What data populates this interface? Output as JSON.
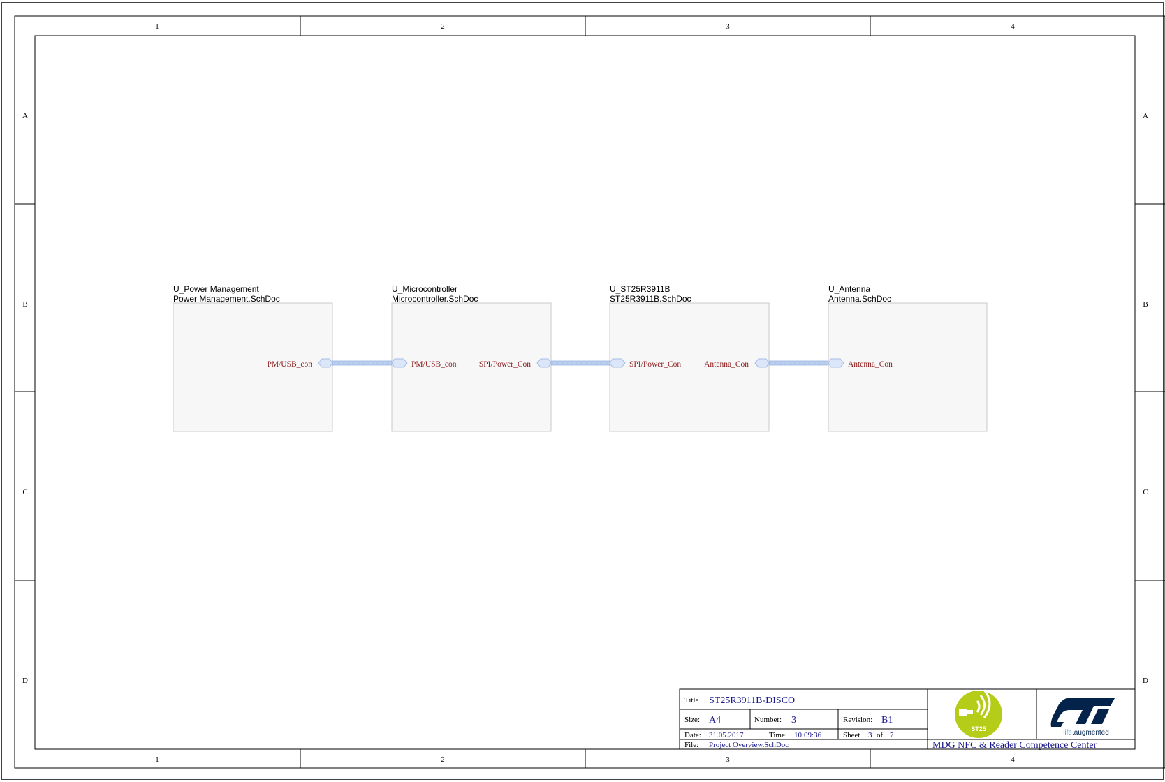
{
  "border": {
    "columns": [
      "1",
      "2",
      "3",
      "4"
    ],
    "rows": [
      "A",
      "B",
      "C",
      "D"
    ]
  },
  "sheets": [
    {
      "designator": "U_Power Management",
      "file": "Power Management.SchDoc",
      "ports": [
        {
          "label": "PM/USB_con",
          "side": "right"
        }
      ]
    },
    {
      "designator": "U_Microcontroller",
      "file": "Microcontroller.SchDoc",
      "ports": [
        {
          "label": "PM/USB_con",
          "side": "left"
        },
        {
          "label": "SPI/Power_Con",
          "side": "right"
        }
      ]
    },
    {
      "designator": "U_ST25R3911B",
      "file": "ST25R3911B.SchDoc",
      "ports": [
        {
          "label": "SPI/Power_Con",
          "side": "left"
        },
        {
          "label": "Antenna_Con",
          "side": "right"
        }
      ]
    },
    {
      "designator": "U_Antenna",
      "file": "Antenna.SchDoc",
      "ports": [
        {
          "label": "Antenna_Con",
          "side": "left"
        }
      ]
    }
  ],
  "title_block": {
    "title_label": "Title",
    "title": "ST25R3911B-DISCO",
    "size_label": "Size:",
    "size": "A4",
    "number_label": "Number:",
    "number": "3",
    "revision_label": "Revision:",
    "revision": "B1",
    "date_label": "Date:",
    "date": "31.05.2017",
    "time_label": "Time:",
    "time": "10:09:36",
    "sheet_label": "Sheet",
    "sheet": "3",
    "of_label": "of",
    "sheet_total": "7",
    "file_label": "File:",
    "file": "Project Overview.SchDoc",
    "company": "MDG NFC & Reader Competence Center",
    "st25_logo_text": "ST25",
    "st_tagline_a": "life",
    "st_tagline_b": ".augmented"
  },
  "colors": {
    "port_text": "#8b1a1a",
    "title_value": "#1a1a8c",
    "bus": "#bcd0f0",
    "sheet_fill": "#f7f7f7",
    "st25_green": "#b5cc18",
    "st_blue": "#03234b"
  }
}
